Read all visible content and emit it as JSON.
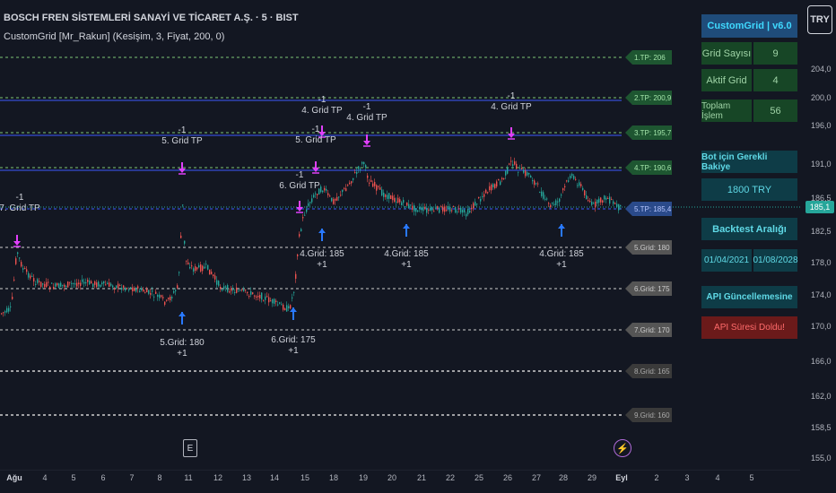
{
  "header": {
    "title": "BOSCH FREN SİSTEMLERİ SANAYİ VE TİCARET A.Ş. · 5 · BIST",
    "indicator": "CustomGrid [Mr_Rakun] (Kesişim, 3, Fiyat, 200, 0)",
    "currency": "TRY"
  },
  "price_axis": [
    "204,0",
    "200,0",
    "196,0",
    "191,0",
    "186,5",
    "182,5",
    "178,0",
    "174,0",
    "170,0",
    "166,0",
    "162,0",
    "158,5",
    "155,0"
  ],
  "current_price": "185,1",
  "date_axis": [
    {
      "label": "Ağu",
      "bold": true
    },
    {
      "label": "4"
    },
    {
      "label": "5"
    },
    {
      "label": "6"
    },
    {
      "label": "7"
    },
    {
      "label": "8"
    },
    {
      "label": "11"
    },
    {
      "label": "12"
    },
    {
      "label": "13"
    },
    {
      "label": "14"
    },
    {
      "label": "15"
    },
    {
      "label": "18"
    },
    {
      "label": "19"
    },
    {
      "label": "20"
    },
    {
      "label": "21"
    },
    {
      "label": "22"
    },
    {
      "label": "25"
    },
    {
      "label": "26"
    },
    {
      "label": "27"
    },
    {
      "label": "28"
    },
    {
      "label": "29"
    },
    {
      "label": "Eyl",
      "bold": true
    },
    {
      "label": "2"
    },
    {
      "label": "3"
    },
    {
      "label": "4"
    },
    {
      "label": "5"
    }
  ],
  "grid_tags": [
    {
      "label": "1.TP: 206",
      "kind": "tp"
    },
    {
      "label": "2.TP: 200,9",
      "kind": "tp"
    },
    {
      "label": "3.TP: 195,7",
      "kind": "tp"
    },
    {
      "label": "4.TP: 190,6",
      "kind": "tp"
    },
    {
      "label": "5.TP: 185,4",
      "kind": "tp-blue"
    },
    {
      "label": "5.Grid: 180",
      "kind": "grid"
    },
    {
      "label": "6.Grid: 175",
      "kind": "grid"
    },
    {
      "label": "7.Grid: 170",
      "kind": "grid"
    },
    {
      "label": "8.Grid: 165",
      "kind": "grid-dim"
    },
    {
      "label": "9.Grid: 160",
      "kind": "grid-dim"
    }
  ],
  "annotations": {
    "tp7": {
      "top": "-1",
      "text": "7. Grid TP"
    },
    "tp5": {
      "top": "-1",
      "text": "5. Grid TP"
    },
    "tp6": {
      "top": "-1",
      "text": "6. Grid TP"
    },
    "tp5b": {
      "top": "-1",
      "text": "5. Grid TP"
    },
    "tp4a": {
      "top": "-1",
      "text": "4. Grid TP"
    },
    "tp4b": {
      "top": "-1",
      "text": "4. Grid TP"
    },
    "tp4c": {
      "top": "-1",
      "text": "4. Grid TP"
    },
    "g5": {
      "text": "5.Grid: 180",
      "bottom": "+1"
    },
    "g6": {
      "text": "6.Grid: 175",
      "bottom": "+1"
    },
    "g4a": {
      "text": "4.Grid: 185",
      "bottom": "+1"
    },
    "g4b": {
      "text": "4.Grid: 185",
      "bottom": "+1"
    },
    "g4c": {
      "text": "4.Grid: 185",
      "bottom": "+1"
    }
  },
  "panel": {
    "title": "CustomGrid | v6.0",
    "grid_count_label": "Grid Sayısı",
    "grid_count": "9",
    "active_grid_label": "Aktif Grid",
    "active_grid": "4",
    "total_trades_label": "Toplam İşlem",
    "total_trades": "56",
    "balance_title": "Bot için Gerekli Bakiye",
    "balance": "1800 TRY",
    "backtest_title": "Backtest Aralığı",
    "backtest_start": "01/04/2021",
    "backtest_end": "01/08/2028",
    "api_title": "API Güncellemesine",
    "api_status": "API Süresi Doldu!"
  },
  "colors": {
    "up": "#26a69a",
    "down": "#ef5350",
    "tp_line": "#7cc576",
    "entry_line": "#3d5afe",
    "grid_line": "#cfcfcf",
    "tp_marker": "#e040fb",
    "buy_marker": "#2979ff"
  },
  "icons": {
    "e": "E",
    "bolt": "⚡"
  }
}
